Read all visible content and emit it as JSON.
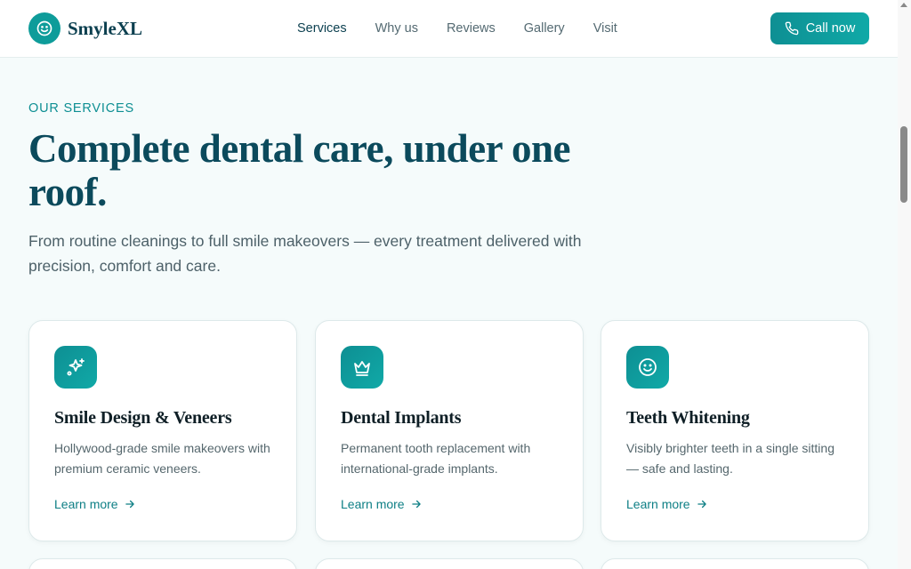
{
  "brand": {
    "name": "SmyleXL",
    "logo_icon": "smile-icon"
  },
  "nav": {
    "items": [
      {
        "label": "Services",
        "active": true
      },
      {
        "label": "Why us",
        "active": false
      },
      {
        "label": "Reviews",
        "active": false
      },
      {
        "label": "Gallery",
        "active": false
      },
      {
        "label": "Visit",
        "active": false
      }
    ]
  },
  "header": {
    "call_label": "Call now",
    "call_icon": "phone-icon"
  },
  "hero": {
    "eyebrow": "OUR SERVICES",
    "headline": "Complete dental care, under one roof.",
    "lede": "From routine cleanings to full smile makeovers — every treatment delivered with precision, comfort and care."
  },
  "services": [
    {
      "icon": "sparkles-icon",
      "title": "Smile Design & Veneers",
      "description": "Hollywood-grade smile makeovers with premium ceramic veneers.",
      "link": "Learn more"
    },
    {
      "icon": "crown-icon",
      "title": "Dental Implants",
      "description": "Permanent tooth replacement with international-grade implants.",
      "link": "Learn more"
    },
    {
      "icon": "smile-icon",
      "title": "Teeth Whitening",
      "description": "Visibly brighter teeth in a single sitting — safe and lasting.",
      "link": "Learn more"
    }
  ],
  "colors": {
    "accent": "#0e9c9a",
    "heading": "#0b4a5c",
    "background": "#f5fbfb"
  }
}
